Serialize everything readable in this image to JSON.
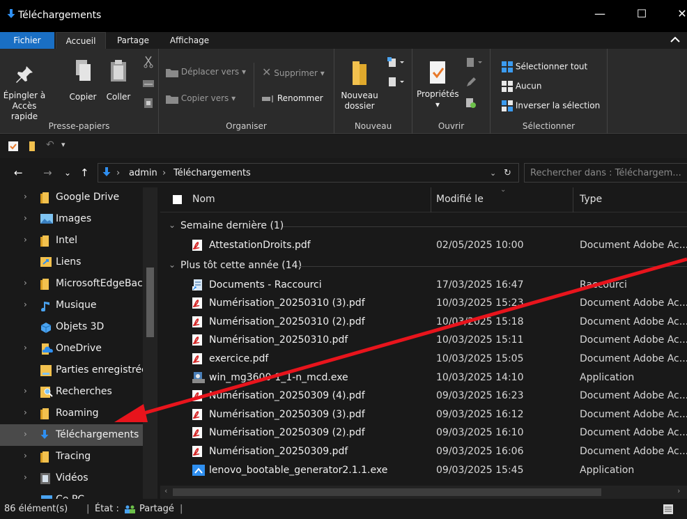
{
  "window": {
    "title": "Téléchargements",
    "minimize": "—",
    "maximize": "☐",
    "close": "✕"
  },
  "ribbon_tabs": [
    "Fichier",
    "Accueil",
    "Partage",
    "Affichage"
  ],
  "ribbon": {
    "presse_papiers": {
      "label": "Presse-papiers",
      "pin_line1": "Épingler à",
      "pin_line2": "Accès rapide",
      "copy": "Copier",
      "paste": "Coller"
    },
    "organiser": {
      "label": "Organiser",
      "move_to": "Déplacer vers",
      "copy_to": "Copier vers",
      "delete": "Supprimer",
      "rename": "Renommer"
    },
    "nouveau": {
      "label": "Nouveau",
      "new_folder_line1": "Nouveau",
      "new_folder_line2": "dossier"
    },
    "ouvrir": {
      "label": "Ouvrir",
      "properties": "Propriétés"
    },
    "selectionner": {
      "label": "Sélectionner",
      "select_all": "Sélectionner tout",
      "none": "Aucun",
      "invert": "Inverser la sélection"
    }
  },
  "address": {
    "crumbs": [
      "admin",
      "Téléchargements"
    ],
    "search_placeholder": "Rechercher dans : Téléchargem..."
  },
  "nav_items": [
    {
      "label": "Google Drive",
      "icon": "folder-icon",
      "expandable": true
    },
    {
      "label": "Images",
      "icon": "pictures-folder-icon",
      "expandable": true
    },
    {
      "label": "Intel",
      "icon": "folder-icon",
      "expandable": true
    },
    {
      "label": "Liens",
      "icon": "links-folder-icon",
      "expandable": false
    },
    {
      "label": "MicrosoftEdgeBack",
      "icon": "folder-icon",
      "expandable": true
    },
    {
      "label": "Musique",
      "icon": "music-icon",
      "expandable": true
    },
    {
      "label": "Objets 3D",
      "icon": "3d-objects-icon",
      "expandable": false
    },
    {
      "label": "OneDrive",
      "icon": "onedrive-folder-icon",
      "expandable": true
    },
    {
      "label": "Parties enregistrées",
      "icon": "saved-games-icon",
      "expandable": false
    },
    {
      "label": "Recherches",
      "icon": "searches-icon",
      "expandable": true
    },
    {
      "label": "Roaming",
      "icon": "folder-icon",
      "expandable": true
    },
    {
      "label": "Téléchargements",
      "icon": "downloads-icon",
      "expandable": true,
      "selected": true
    },
    {
      "label": "Tracing",
      "icon": "folder-icon",
      "expandable": true
    },
    {
      "label": "Vidéos",
      "icon": "videos-icon",
      "expandable": true
    },
    {
      "label": "Ce PC",
      "icon": "this-pc-icon",
      "expandable": true,
      "expanded": true
    }
  ],
  "columns": {
    "name": "Nom",
    "modified": "Modifié le",
    "type": "Type"
  },
  "groups": [
    {
      "name": "Semaine dernière (1)",
      "files": [
        {
          "name": "AttestationDroits.pdf",
          "date": "02/05/2025 10:00",
          "type": "Document Adobe Ac...",
          "icon": "pdf-icon"
        }
      ]
    },
    {
      "name": "Plus tôt cette année (14)",
      "files": [
        {
          "name": "Documents - Raccourci",
          "date": "17/03/2025 16:47",
          "type": "Raccourci",
          "icon": "shortcut-icon"
        },
        {
          "name": "Numérisation_20250310 (3).pdf",
          "date": "10/03/2025 15:23",
          "type": "Document Adobe Ac...",
          "icon": "pdf-icon"
        },
        {
          "name": "Numérisation_20250310 (2).pdf",
          "date": "10/03/2025 15:18",
          "type": "Document Adobe Ac...",
          "icon": "pdf-icon"
        },
        {
          "name": "Numérisation_20250310.pdf",
          "date": "10/03/2025 15:11",
          "type": "Document Adobe Ac...",
          "icon": "pdf-icon"
        },
        {
          "name": "exercice.pdf",
          "date": "10/03/2025 15:05",
          "type": "Document Adobe Ac...",
          "icon": "pdf-icon"
        },
        {
          "name": "win_mg3600-1_1-n_mcd.exe",
          "date": "10/03/2025 14:10",
          "type": "Application",
          "icon": "installer-icon"
        },
        {
          "name": "Numérisation_20250309 (4).pdf",
          "date": "09/03/2025 16:23",
          "type": "Document Adobe Ac...",
          "icon": "pdf-icon"
        },
        {
          "name": "Numérisation_20250309 (3).pdf",
          "date": "09/03/2025 16:12",
          "type": "Document Adobe Ac...",
          "icon": "pdf-icon"
        },
        {
          "name": "Numérisation_20250309 (2).pdf",
          "date": "09/03/2025 16:10",
          "type": "Document Adobe Ac...",
          "icon": "pdf-icon"
        },
        {
          "name": "Numérisation_20250309.pdf",
          "date": "09/03/2025 16:06",
          "type": "Document Adobe Ac...",
          "icon": "pdf-icon"
        },
        {
          "name": "lenovo_bootable_generator2.1.1.exe",
          "date": "09/03/2025 15:45",
          "type": "Application",
          "icon": "exe-icon"
        }
      ]
    }
  ],
  "status": {
    "count": "86 élément(s)",
    "state_label": "État :",
    "state_value": "Partagé"
  },
  "colors": {
    "file_tab": "#1a6fc4",
    "selected_nav": "#4a4a4a",
    "arrow": "#e8141c",
    "folder": "#f2c14e"
  }
}
